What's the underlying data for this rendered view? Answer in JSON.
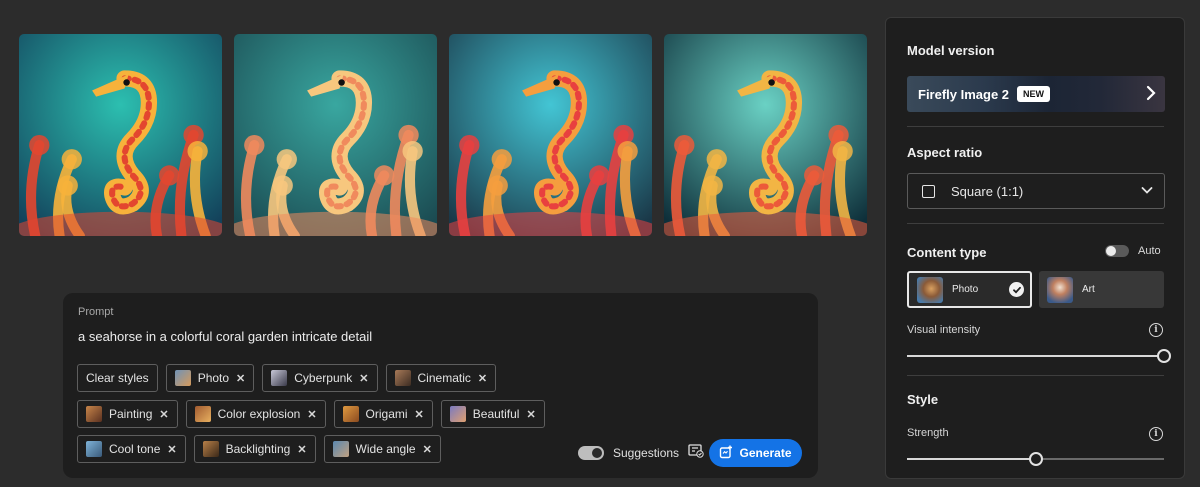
{
  "gallery": {
    "images": [
      {
        "name": "seahorse-image-1",
        "palette": [
          "#e3462f",
          "#f7b23b",
          "#2cbfb0",
          "#13425b"
        ]
      },
      {
        "name": "seahorse-image-2",
        "palette": [
          "#f08a5d",
          "#f7c77e",
          "#39a7a0",
          "#1b4b52"
        ]
      },
      {
        "name": "seahorse-image-3",
        "palette": [
          "#e8403f",
          "#f59e3e",
          "#43c5d4",
          "#1a3848"
        ]
      },
      {
        "name": "seahorse-image-4",
        "palette": [
          "#ec5a3a",
          "#f2b544",
          "#6ad1c4",
          "#0e2f3a"
        ]
      }
    ]
  },
  "prompt": {
    "label": "Prompt",
    "text": "a seahorse in a colorful coral garden intricate detail",
    "clear_styles": "Clear styles",
    "chips_row1": [
      {
        "label": "Photo",
        "color": "#6f93b8"
      },
      {
        "label": "Cyberpunk",
        "color": "#c8c8d8"
      },
      {
        "label": "Cinematic",
        "color": "#a87a58"
      }
    ],
    "chips_row2": [
      {
        "label": "Painting",
        "color": "#c8864a"
      },
      {
        "label": "Color explosion",
        "color": "#a05a30"
      },
      {
        "label": "Origami",
        "color": "#e09a40"
      },
      {
        "label": "Beautiful",
        "color": "#7a7ac0"
      }
    ],
    "chips_row3": [
      {
        "label": "Cool tone",
        "color": "#7fb3d8"
      },
      {
        "label": "Backlighting",
        "color": "#b88048"
      },
      {
        "label": "Wide angle",
        "color": "#5a88b0"
      }
    ],
    "suggestions_label": "Suggestions",
    "generate_label": "Generate"
  },
  "sidebar": {
    "model_version_title": "Model version",
    "model_name": "Firefly Image 2",
    "new_badge": "NEW",
    "aspect_ratio_title": "Aspect ratio",
    "aspect_ratio_value": "Square (1:1)",
    "content_type_title": "Content type",
    "auto_label": "Auto",
    "content_photo": "Photo",
    "content_art": "Art",
    "visual_intensity_label": "Visual intensity",
    "visual_intensity_value": 1.0,
    "style_title": "Style",
    "strength_label": "Strength",
    "strength_value": 0.5
  },
  "colors": {
    "accent": "#1473e6",
    "panel": "#1e1e1e",
    "background": "#2c2c2c"
  }
}
